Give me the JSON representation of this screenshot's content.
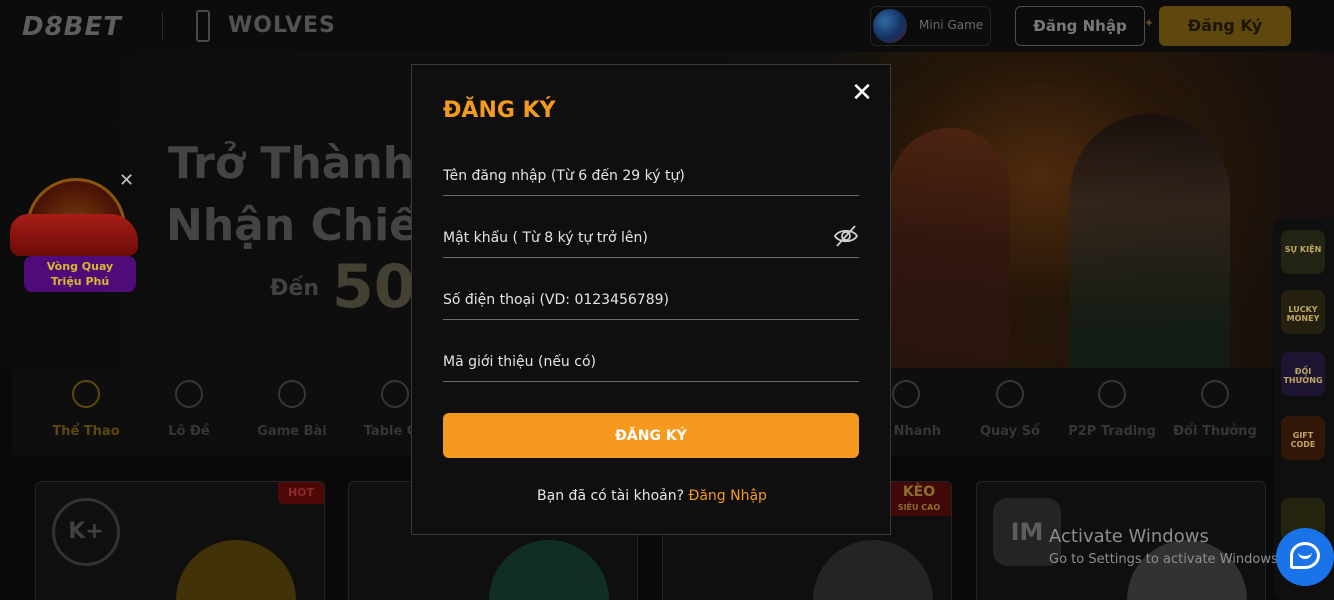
{
  "header": {
    "logo": "D8BET",
    "partner": "WOLVES",
    "minigame_label": "Mini Game",
    "login_label": "Đăng Nhập",
    "register_label": "Đăng Ký"
  },
  "hero": {
    "line1": "Trở Thành",
    "line2": "Nhận Chiế",
    "prefix": "Đến",
    "amount": "50"
  },
  "promo": {
    "banner_line1": "Vòng Quay",
    "banner_line2": "Triệu Phú"
  },
  "categories": [
    {
      "label": "Thể Thao",
      "active": true
    },
    {
      "label": "Lô Đề"
    },
    {
      "label": "Game Bài"
    },
    {
      "label": "Table Ga"
    },
    {
      "label": "ne Nhanh"
    },
    {
      "label": "Quay Số"
    },
    {
      "label": "P2P Trading"
    },
    {
      "label": "Đổi Thưởng"
    }
  ],
  "rail": [
    "SỰ KIỆN",
    "LUCKY MONEY",
    "ĐỐI THƯỞNG",
    "GIFT CODE",
    ""
  ],
  "cards": {
    "hot_badge": "HOT",
    "keo_badge": "KÈO",
    "keo_sub": "SIÊU CAO",
    "k_logo": "K+",
    "im_logo": "IM"
  },
  "modal": {
    "title": "ĐĂNG KÝ",
    "username_placeholder": "Tên đăng nhập (Từ 6 đến 29 ký tự)",
    "password_placeholder": "Mật khẩu ( Từ 8 ký tự trở lên)",
    "phone_placeholder": "Số điện thoại (VD: 0123456789)",
    "referral_placeholder": "Mã giới thiệu (nếu có)",
    "submit_label": "ĐĂNG KÝ",
    "footer_text": "Bạn đã có tài khoản?",
    "footer_link": "Đăng Nhập"
  },
  "watermark": {
    "title": "Activate Windows",
    "subtitle": "Go to Settings to activate Windows."
  },
  "colors": {
    "accent": "#f59a1e",
    "modal_bg": "#0f0f0f",
    "page_bg": "#0b0b0b"
  }
}
